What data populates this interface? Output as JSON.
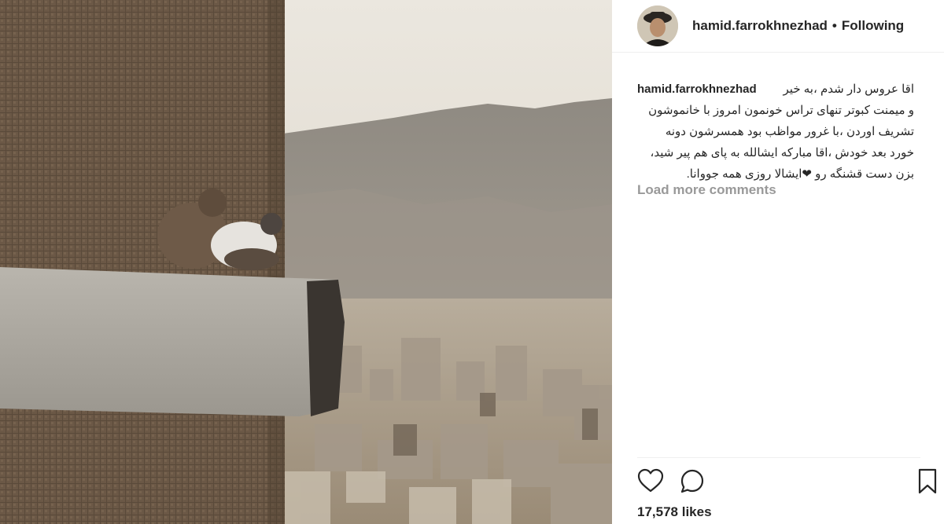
{
  "post": {
    "username": "hamid.farrokhnezhad",
    "separator": "•",
    "follow_status": "Following",
    "caption_user": "hamid.farrokhnezhad",
    "caption_lines": [
      "اقا عروس دار شدم ،به خیر",
      "و میمنت کبوتر تنهای تراس خونمون امروز با خانموشون",
      "تشریف اوردن ،با غرور مواظب بود همسرشون دونه",
      "خورد بعد خودش ،اقا مبارکه ایشالله به پای هم پیر شید،",
      "بزن دست قشنگه رو ❤ایشالا روزی همه جووانا."
    ],
    "load_more": "Load more comments",
    "likes": "17,578 likes"
  },
  "icons": {
    "like": "heart-outline-icon",
    "comment": "speech-bubble-icon",
    "save": "bookmark-icon"
  },
  "colors": {
    "text": "#262626",
    "muted": "#999999",
    "divider": "#efefef"
  }
}
